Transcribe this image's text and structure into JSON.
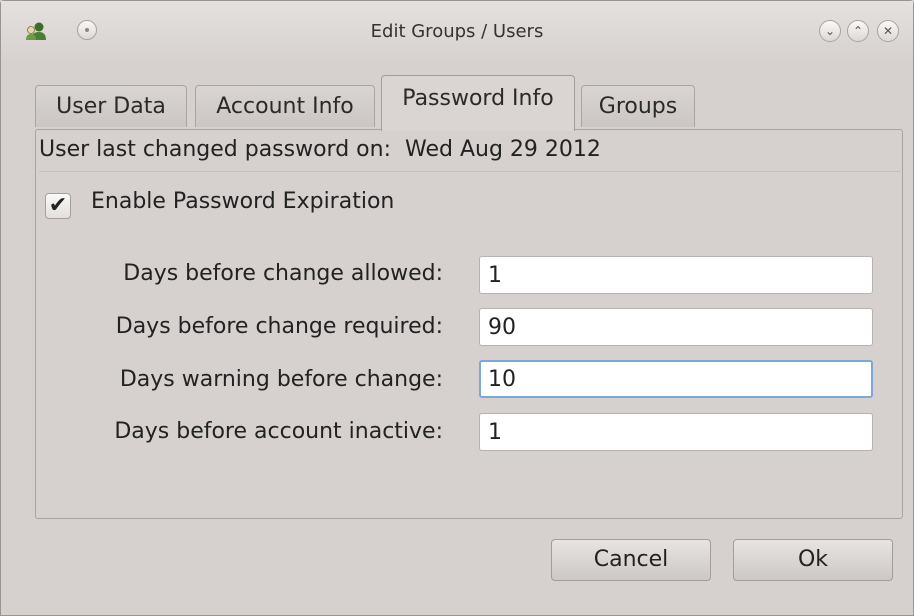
{
  "window": {
    "title": "Edit Groups / Users",
    "app_icon": "users-icon",
    "menu_icon": "window-menu-icon",
    "controls": [
      {
        "name": "minimize-icon",
        "glyph": "⌄"
      },
      {
        "name": "maximize-icon",
        "glyph": "⌃"
      },
      {
        "name": "close-icon",
        "glyph": "✕"
      }
    ]
  },
  "tabs": [
    {
      "label": "User Data",
      "active": false
    },
    {
      "label": "Account Info",
      "active": false
    },
    {
      "label": "Password Info",
      "active": true
    },
    {
      "label": "Groups",
      "active": false
    }
  ],
  "password_info": {
    "last_changed_label": "User last changed password on:",
    "last_changed_value": "Wed Aug 29 2012",
    "expiration_checkbox": {
      "label": "Enable Password Expiration",
      "checked": true
    },
    "fields": [
      {
        "label": "Days before change allowed:",
        "value": "1"
      },
      {
        "label": "Days before change required:",
        "value": "90"
      },
      {
        "label": "Days warning before change:",
        "value": "10",
        "focused": true
      },
      {
        "label": "Days before account inactive:",
        "value": "1"
      }
    ]
  },
  "buttons": {
    "cancel": "Cancel",
    "ok": "Ok"
  }
}
